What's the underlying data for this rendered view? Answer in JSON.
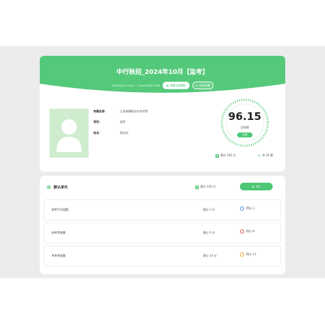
{
  "header": {
    "exam_title": "中行秋招_2024年10月【监考】",
    "time_range": "2024/10/23 14:00 ~ 2024/10/26 23:59",
    "view_answers_label": "答题试卷解析",
    "retake_label": "再次答题"
  },
  "candidate": {
    "fields": [
      {
        "label": "考籍名称：",
        "value": "江苏海事职业技术学院"
      },
      {
        "label": "角色：",
        "value": "监考"
      },
      {
        "label": "姓名：",
        "value": "周沃杰"
      }
    ]
  },
  "score": {
    "value": "96.15",
    "label": "总成绩",
    "status": "合格",
    "full_mark": "满分 100 分",
    "question_count": "共 26 题"
  },
  "section": {
    "title": "默认单元",
    "full_mark": "满分 100 分",
    "score": "0分",
    "items": [
      {
        "name": "校考平均组题",
        "full": "满分 3 分",
        "got": "得分 3",
        "ring_color": "#4a90e2"
      },
      {
        "name": "校考考核题",
        "full": "满分 9 分",
        "got": "得分 9",
        "ring_color": "#e05a5a"
      },
      {
        "name": "考考考核题",
        "full": "满分 14 分",
        "got": "得分 13",
        "ring_color": "#f0a13a"
      }
    ]
  },
  "colors": {
    "accent": "#4cc774",
    "background": "#ececec"
  },
  "icons": [
    "eye-icon",
    "refresh-icon",
    "avatar-placeholder",
    "score-ring",
    "grid-icon",
    "trophy-icon"
  ]
}
